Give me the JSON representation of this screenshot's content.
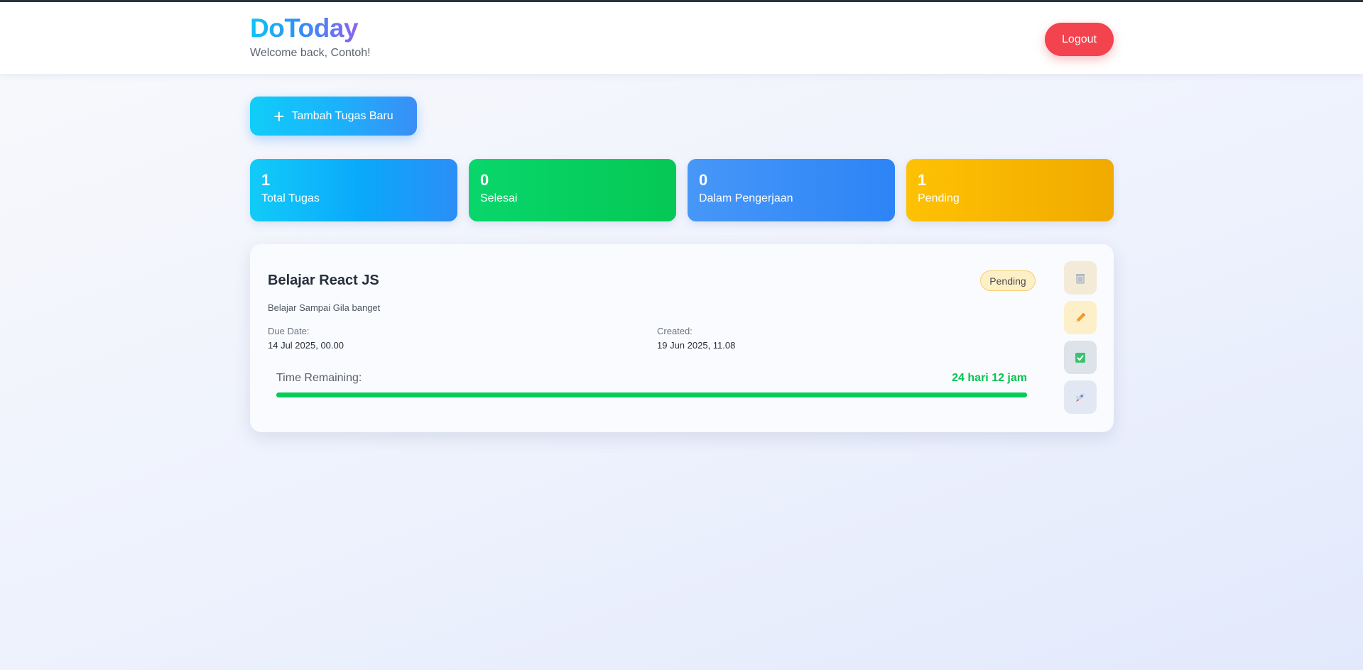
{
  "header": {
    "brand": "DoToday",
    "welcome": "Welcome back, Contoh!",
    "logout_label": "Logout"
  },
  "toolbar": {
    "add_label": "Tambah Tugas Baru",
    "add_icon": "plus-icon"
  },
  "stats": [
    {
      "value": "1",
      "label": "Total Tugas",
      "color": "#12cbf8"
    },
    {
      "value": "0",
      "label": "Selesai",
      "color": "#05c855"
    },
    {
      "value": "0",
      "label": "Dalam Pengerjaan",
      "color": "#2d84f6"
    },
    {
      "value": "1",
      "label": "Pending",
      "color": "#f1aa00"
    }
  ],
  "task": {
    "title": "Belajar React JS",
    "status": "Pending",
    "description": "Belajar Sampai Gila banget",
    "due_label": "Due Date:",
    "due_value": "14 Jul 2025, 00.00",
    "created_label": "Created:",
    "created_value": "19 Jun 2025, 11.08",
    "time_label": "Time Remaining:",
    "time_value": "24 hari 12 jam",
    "progress_fraction": 1.0,
    "progress_color": "#06cb58",
    "actions": [
      {
        "name": "delete",
        "icon": "trash-icon"
      },
      {
        "name": "edit",
        "icon": "pencil-icon"
      },
      {
        "name": "complete",
        "icon": "checkmark-icon"
      },
      {
        "name": "start",
        "icon": "rocket-icon"
      }
    ]
  }
}
